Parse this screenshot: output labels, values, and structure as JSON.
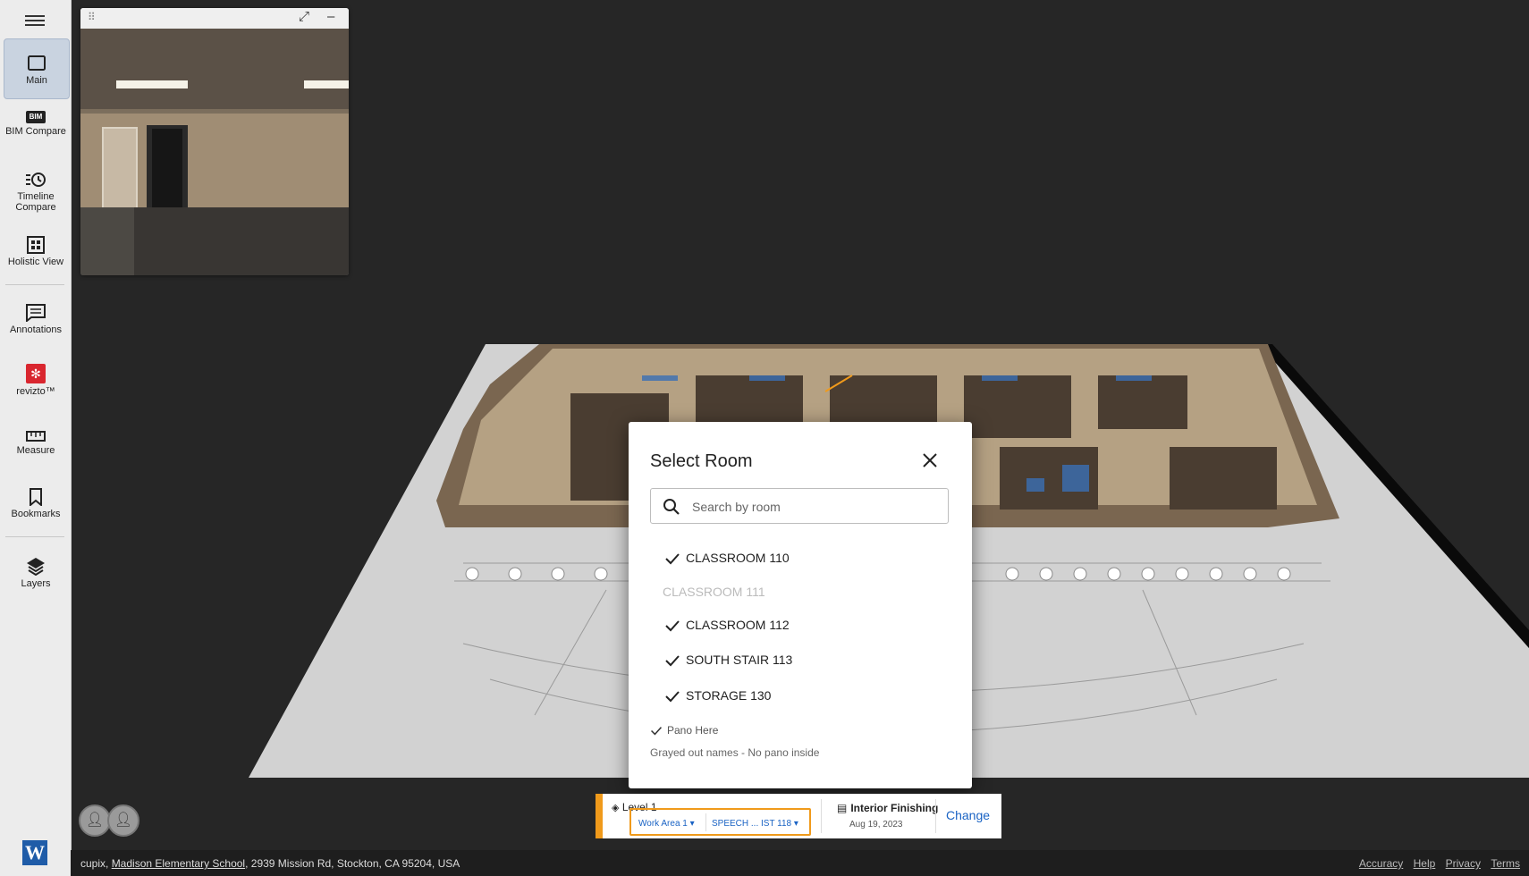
{
  "sidebar": {
    "items": [
      {
        "label": "Main",
        "icon": "square-icon"
      },
      {
        "label": "BIM Compare",
        "badge": "BIM",
        "icon": "bim-icon"
      },
      {
        "label": "Timeline Compare",
        "icon": "timeline-clock-icon"
      },
      {
        "label": "Holistic View",
        "icon": "grid-icon"
      },
      {
        "label": "Annotations",
        "icon": "annotation-icon"
      },
      {
        "label": "revizto™",
        "icon": "revizto-icon"
      },
      {
        "label": "Measure",
        "icon": "ruler-icon"
      },
      {
        "label": "Bookmarks",
        "icon": "bookmark-icon"
      },
      {
        "label": "Layers",
        "icon": "layers-icon"
      }
    ],
    "logo_letter": "W",
    "accent": "#1f5ca8"
  },
  "modal": {
    "title": "Select Room",
    "search_placeholder": "Search by room",
    "rooms": [
      {
        "name": "CLASSROOM 110",
        "has_pano": true
      },
      {
        "name": "CLASSROOM 111",
        "has_pano": false
      },
      {
        "name": "CLASSROOM 112",
        "has_pano": true
      },
      {
        "name": "SOUTH STAIR 113",
        "has_pano": true
      },
      {
        "name": "STORAGE 130",
        "has_pano": true
      }
    ],
    "legend_pano": "Pano Here",
    "legend_grayed": "Grayed out names - No pano inside"
  },
  "infocard": {
    "level": "Level 1",
    "work_area": "Work Area 1",
    "room": "SPEECH ... IST 118",
    "scenario": "Interior Finishing",
    "date": "Aug 19, 2023",
    "change_label": "Change",
    "accent": "#f09a1b"
  },
  "footer": {
    "company": "cupix, ",
    "project_link": "Madison Elementary School",
    "address": ", 2939 Mission Rd, Stockton, CA 95204, USA",
    "links": [
      "Accuracy",
      "Help",
      "Privacy",
      "Terms"
    ]
  }
}
